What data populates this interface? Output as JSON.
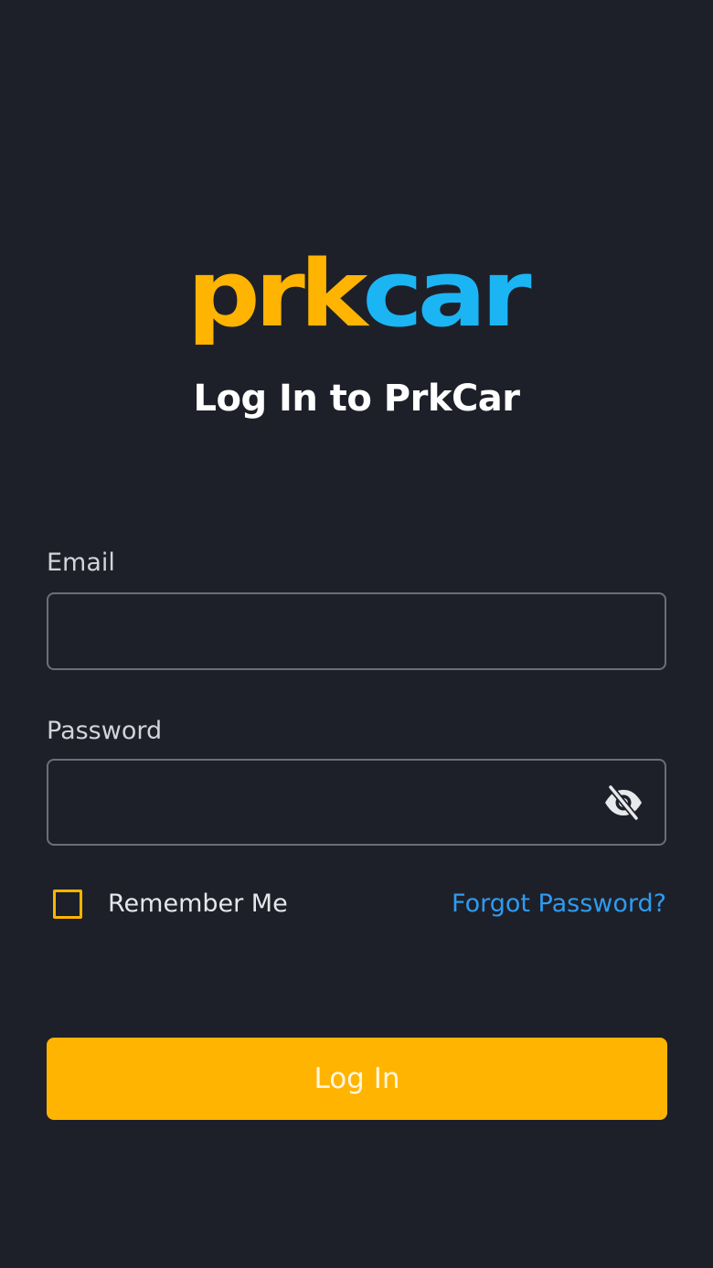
{
  "logo": {
    "part1": "prk",
    "part2": "car"
  },
  "title": "Log In to PrkCar",
  "form": {
    "email_label": "Email",
    "email_value": "",
    "password_label": "Password",
    "password_value": "",
    "password_toggle_icon": "eye-off-icon",
    "remember_label": "Remember Me",
    "remember_checked": false,
    "forgot_label": "Forgot Password?",
    "submit_label": "Log In"
  },
  "colors": {
    "background": "#1e2029",
    "brand_yellow": "#ffb402",
    "brand_blue": "#1bb5f4",
    "link": "#2d9cf0"
  }
}
